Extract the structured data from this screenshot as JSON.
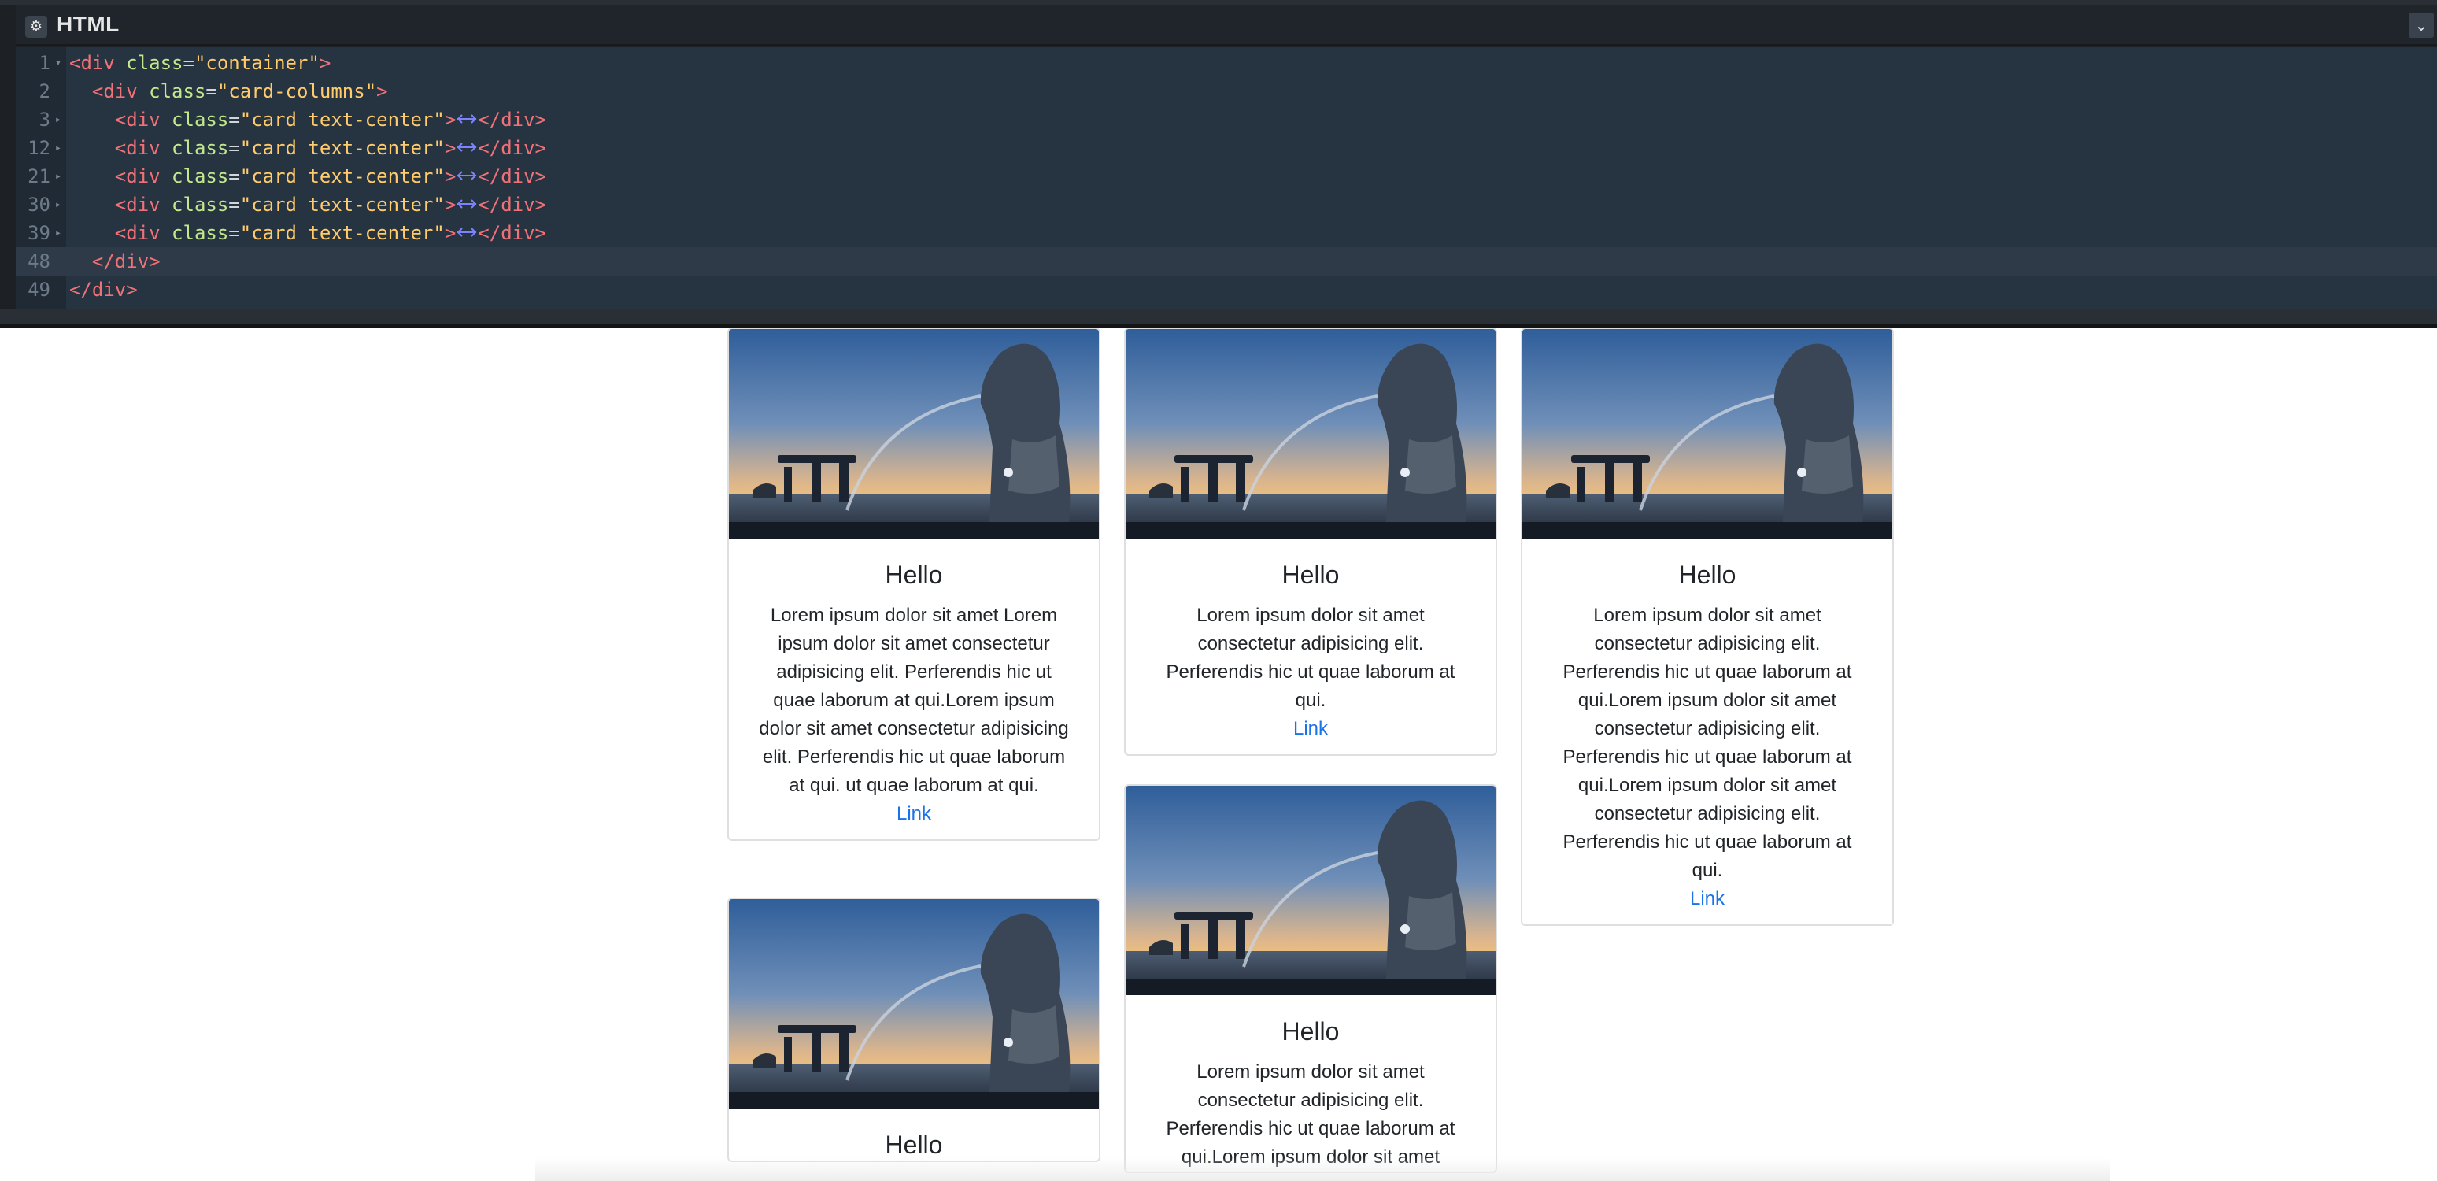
{
  "editor": {
    "title": "HTML",
    "settings_icon": "gear-icon",
    "collapse_icon": "chevron-down-icon",
    "lines": [
      {
        "num": "1",
        "fold": "open",
        "indent": "",
        "tag": "div",
        "attr": "class",
        "value": "container",
        "folded": false,
        "closing": false
      },
      {
        "num": "2",
        "fold": "none",
        "indent": "  ",
        "tag": "div",
        "attr": "class",
        "value": "card-columns",
        "folded": false,
        "closing": false
      },
      {
        "num": "3",
        "fold": "closed",
        "indent": "    ",
        "tag": "div",
        "attr": "class",
        "value": "card text-center",
        "folded": true,
        "closing": false
      },
      {
        "num": "12",
        "fold": "closed",
        "indent": "    ",
        "tag": "div",
        "attr": "class",
        "value": "card text-center",
        "folded": true,
        "closing": false
      },
      {
        "num": "21",
        "fold": "closed",
        "indent": "    ",
        "tag": "div",
        "attr": "class",
        "value": "card text-center",
        "folded": true,
        "closing": false
      },
      {
        "num": "30",
        "fold": "closed",
        "indent": "    ",
        "tag": "div",
        "attr": "class",
        "value": "card text-center",
        "folded": true,
        "closing": false
      },
      {
        "num": "39",
        "fold": "closed",
        "indent": "    ",
        "tag": "div",
        "attr": "class",
        "value": "card text-center",
        "folded": true,
        "closing": false
      },
      {
        "num": "48",
        "fold": "none",
        "indent": "  ",
        "tag": "div",
        "attr": "",
        "value": "",
        "folded": false,
        "closing": true
      },
      {
        "num": "49",
        "fold": "none",
        "indent": "",
        "tag": "div",
        "attr": "",
        "value": "",
        "folded": false,
        "closing": true
      }
    ],
    "colors": {
      "tag": "#f07178",
      "attr": "#c3e88d",
      "string": "#ffcb6b",
      "fold_marker": "#7c83ff"
    }
  },
  "cards": [
    {
      "title": "Hello",
      "text": "Lorem ipsum dolor sit amet Lorem ipsum dolor sit amet consectetur adipisicing elit. Perferendis hic ut quae laborum at qui.Lorem ipsum dolor sit amet consectetur adipisicing elit. Perferendis hic ut quae laborum at qui. ut quae laborum at qui.",
      "link": "Link"
    },
    {
      "title": "Hello",
      "text": "Lorem ipsum dolor sit amet consectetur adipisicing elit. Perferendis hic ut quae laborum at qui.",
      "link": "Link"
    },
    {
      "title": "Hello",
      "text": "Lorem ipsum dolor sit amet consectetur adipisicing elit. Perferendis hic ut quae laborum at qui.Lorem ipsum dolor sit amet consectetur adipisicing elit. Perferendis hic ut quae laborum at qui.Lorem ipsum dolor sit amet consectetur adipisicing elit. Perferendis hic ut quae laborum at qui.",
      "link": "Link"
    },
    {
      "title": "Hello",
      "text": "Lorem ipsum dolor sit amet consectetur adipisicing elit. Perferendis hic ut quae laborum at qui.Lorem ipsum dolor sit amet",
      "link": ""
    },
    {
      "title": "Hello",
      "text": "",
      "link": ""
    }
  ],
  "link_color": "#1a73e8"
}
